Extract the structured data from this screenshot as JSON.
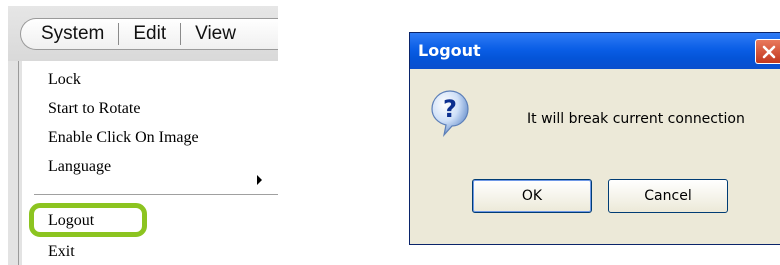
{
  "menubar": {
    "items": [
      {
        "label": "System"
      },
      {
        "label": "Edit"
      },
      {
        "label": "View"
      }
    ]
  },
  "menu": {
    "items": [
      {
        "label": "Lock"
      },
      {
        "label": "Start to Rotate"
      },
      {
        "label": "Enable Click On Image"
      },
      {
        "label": "Language"
      },
      {
        "label": "Logout"
      },
      {
        "label": "Exit"
      }
    ]
  },
  "dialog": {
    "title": "Logout",
    "message": "It will break current connection",
    "ok_label": "OK",
    "cancel_label": "Cancel"
  },
  "colors": {
    "highlight": "#8cc420",
    "titlebar": "#0a5ee6",
    "dialog_bg": "#ece9d8",
    "close_button": "#d9512f"
  }
}
